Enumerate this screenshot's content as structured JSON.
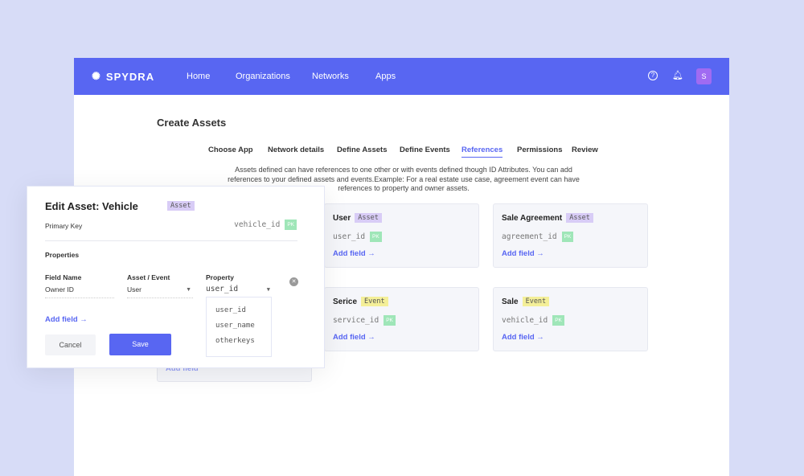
{
  "header": {
    "brand": "SPYDRA",
    "nav": [
      "Home",
      "Organizations",
      "Networks",
      "Apps"
    ],
    "avatar": "S",
    "accent": "#5866f2"
  },
  "page": {
    "title": "Create Assets",
    "tabs": [
      "Choose App",
      "Network details",
      "Define Assets",
      "Define Events",
      "References",
      "Permissions",
      "Review"
    ],
    "active_tab": "References",
    "description": "Assets defined can have references to one other or with events defined though ID Attributes. You can add references to your defined assets and events.Example: For a real estate use case, agreement event can have references to property and owner assets."
  },
  "cards": [
    {
      "name": "User",
      "type": "Asset",
      "key": "user_id",
      "pk": "PK",
      "add": "Add field"
    },
    {
      "name": "Sale Agreement",
      "type": "Asset",
      "key": "agreement_id",
      "pk": "PK",
      "add": "Add field"
    },
    {
      "name": "Serice",
      "type": "Event",
      "key": "service_id",
      "pk": "PK",
      "add": "Add field"
    },
    {
      "name": "Sale",
      "type": "Event",
      "key": "vehicle_id",
      "pk": "PK",
      "add": "Add field"
    }
  ],
  "hidden_card_add": "Add field",
  "modal": {
    "title": "Edit Asset: Vehicle",
    "badge": "Asset",
    "primary_key_label": "Primary Key",
    "primary_key": "vehicle_id",
    "pk": "PK",
    "properties_label": "Properties",
    "columns": [
      "Field Name",
      "Asset / Event",
      "Property"
    ],
    "field_name": "Owner ID",
    "asset_event": "User",
    "property": "user_id",
    "options": [
      "user_id",
      "user_name",
      "otherkeys"
    ],
    "add_field": "Add field",
    "cancel": "Cancel",
    "save": "Save"
  }
}
